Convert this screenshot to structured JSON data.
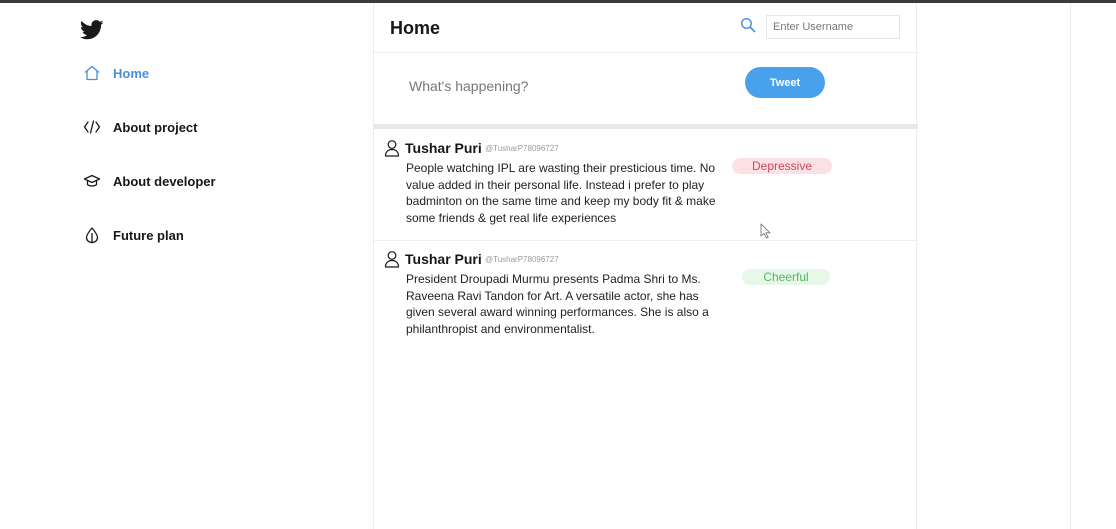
{
  "sidebar": {
    "items": [
      {
        "label": "Home",
        "icon": "home-icon",
        "active": true
      },
      {
        "label": "About project",
        "icon": "code-icon"
      },
      {
        "label": "About developer",
        "icon": "graduation-cap-icon"
      },
      {
        "label": "Future plan",
        "icon": "droplet-icon"
      }
    ]
  },
  "header": {
    "title": "Home",
    "search_placeholder": "Enter Username"
  },
  "compose": {
    "placeholder": "What's happening?",
    "tweet_button": "Tweet"
  },
  "tweets": [
    {
      "name": "Tushar Puri",
      "handle": "@TusharP78096727",
      "text": "People watching IPL are wasting their presticious time. No value added in their personal life. Instead i prefer to play badminton on the same time and keep my body fit & make some friends & get real life experiences",
      "sentiment": "Depressive"
    },
    {
      "name": "Tushar Puri",
      "handle": "@TusharP78096727",
      "text": "President Droupadi Murmu presents Padma Shri to Ms. Raveena Ravi Tandon for Art. A versatile actor, she has given several award winning performances. She is also a philanthropist and environmentalist.",
      "sentiment": "Cheerful"
    }
  ],
  "colors": {
    "accent": "#4aa1eb",
    "nav_active": "#4a90d9",
    "depressive_bg": "#fbe1e4",
    "depressive_text": "#cc4a5c",
    "cheerful_bg": "#e8f8e8",
    "cheerful_text": "#4cb86a"
  }
}
